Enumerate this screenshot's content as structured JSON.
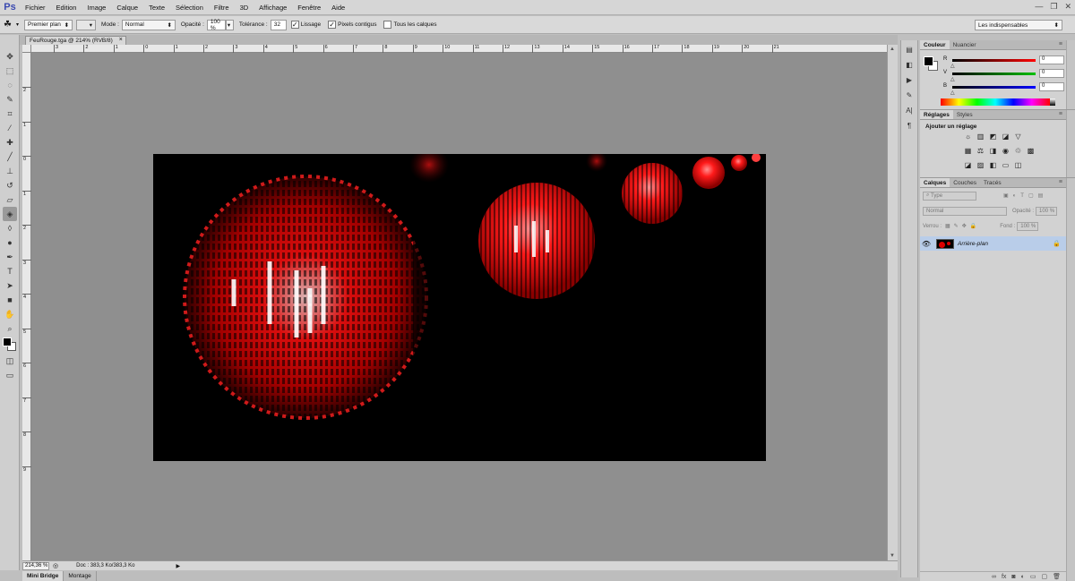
{
  "app": {
    "logo": "Ps"
  },
  "menu": [
    "Fichier",
    "Edition",
    "Image",
    "Calque",
    "Texte",
    "Sélection",
    "Filtre",
    "3D",
    "Affichage",
    "Fenêtre",
    "Aide"
  ],
  "window_controls": {
    "minimize": "—",
    "restore": "❐",
    "close": "✕"
  },
  "options": {
    "mode_source": "Premier plan",
    "mode_label": "Mode :",
    "mode_value": "Normal",
    "opacity_label": "Opacité :",
    "opacity_value": "100 %",
    "tolerance_label": "Tolérance :",
    "tolerance_value": "32",
    "lissage_label": "Lissage",
    "lissage_checked": "✓",
    "contigus_label": "Pixels contigus",
    "contigus_checked": "✓",
    "tous_calques_label": "Tous les calques",
    "workspace": "Les indispensables"
  },
  "document_tab": {
    "title": "FeuRouge.tga @ 214% (RVB/8)",
    "close": "×"
  },
  "ruler_h": [
    "3",
    "2",
    "1",
    "0",
    "1",
    "2",
    "3",
    "4",
    "5",
    "6",
    "7",
    "8",
    "9",
    "10",
    "11",
    "12",
    "13",
    "14",
    "15",
    "16",
    "17",
    "18",
    "19",
    "20",
    "21"
  ],
  "ruler_v": [
    "2",
    "1",
    "0",
    "1",
    "2",
    "3",
    "4",
    "5",
    "6",
    "7",
    "8",
    "9"
  ],
  "status": {
    "zoom": "214,36 %",
    "doc_info": "Doc : 383,3 Ko/383,3 Ko",
    "arrow": "▶"
  },
  "bottom_tabs": [
    "Mini Bridge",
    "Montage"
  ],
  "color_panel": {
    "tabs": [
      "Couleur",
      "Nuancier"
    ],
    "channels": [
      {
        "label": "R",
        "value": "0",
        "color": "#ff0000"
      },
      {
        "label": "V",
        "value": "0",
        "color": "#00c000"
      },
      {
        "label": "B",
        "value": "0",
        "color": "#0000ff"
      }
    ]
  },
  "adjust_panel": {
    "tabs": [
      "Réglages",
      "Styles"
    ],
    "title": "Ajouter un réglage"
  },
  "layers_panel": {
    "tabs": [
      "Calques",
      "Couches",
      "Tracés"
    ],
    "filter_placeholder": "Type",
    "blend_mode": "Normal",
    "opacity_label": "Opacité :",
    "opacity_value": "100 %",
    "lock_label": "Verrou :",
    "fill_label": "Fond :",
    "fill_value": "100 %",
    "layer_name": "Arrière-plan"
  },
  "colors": {
    "accent_selection": "#b9cde9",
    "canvas_bg": "#8f8f8f",
    "document_bg": "#000000"
  }
}
